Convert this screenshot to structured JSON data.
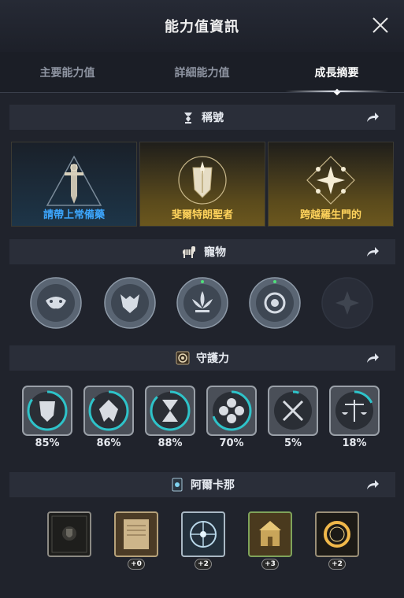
{
  "header": {
    "title": "能力值資訊"
  },
  "tabs": [
    {
      "label": "主要能力值",
      "active": false
    },
    {
      "label": "詳細能力值",
      "active": false
    },
    {
      "label": "成長摘要",
      "active": true
    }
  ],
  "sections": {
    "titles": {
      "label": "稱號",
      "icon": "title-medal-icon"
    },
    "pets": {
      "label": "寵物",
      "icon": "pet-zebra-icon"
    },
    "guardians": {
      "label": "守護力",
      "icon": "guardian-icon"
    },
    "arcana": {
      "label": "阿爾卡那",
      "icon": "arcana-card-icon"
    }
  },
  "titles": [
    {
      "name": "請帶上常備藥",
      "style": "blue",
      "color": "#3da7ff"
    },
    {
      "name": "斐爾特朗聖者",
      "style": "gold",
      "color": "#ffd35c"
    },
    {
      "name": "跨越羅生門的",
      "style": "gold",
      "color": "#ffd35c"
    }
  ],
  "pets": [
    {
      "name": "pet-mask",
      "locked": false,
      "glow": "none"
    },
    {
      "name": "pet-wolf",
      "locked": false,
      "glow": "none"
    },
    {
      "name": "pet-lotus",
      "locked": false,
      "glow": "green"
    },
    {
      "name": "pet-gear",
      "locked": false,
      "glow": "green"
    },
    {
      "name": "pet-flower",
      "locked": true,
      "glow": "none"
    }
  ],
  "guardians": [
    {
      "name": "guardian-shield",
      "percent": "85%",
      "fill": 0.85
    },
    {
      "name": "guardian-wings",
      "percent": "86%",
      "fill": 0.86
    },
    {
      "name": "guardian-hourglass",
      "percent": "88%",
      "fill": 0.88
    },
    {
      "name": "guardian-flower",
      "percent": "70%",
      "fill": 0.7
    },
    {
      "name": "guardian-swords",
      "percent": "5%",
      "fill": 0.05
    },
    {
      "name": "guardian-scales",
      "percent": "18%",
      "fill": 0.18
    }
  ],
  "arcana": [
    {
      "name": "arcana-locked",
      "badge": ""
    },
    {
      "name": "arcana-scroll",
      "badge": "+0"
    },
    {
      "name": "arcana-wheel",
      "badge": "+2"
    },
    {
      "name": "arcana-temple",
      "badge": "+3"
    },
    {
      "name": "arcana-ring",
      "badge": "+2"
    }
  ],
  "colors": {
    "accent_teal": "#2ec3c9",
    "title_blue": "#3da7ff",
    "title_gold": "#ffd35c"
  }
}
